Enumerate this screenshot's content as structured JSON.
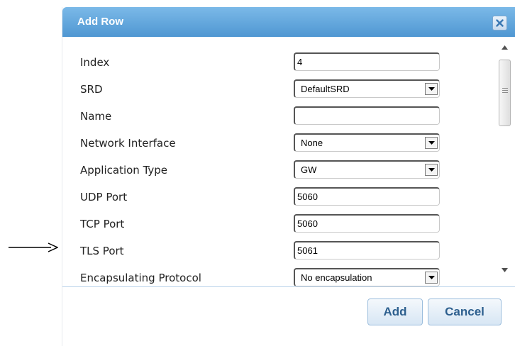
{
  "dialog": {
    "title": "Add Row",
    "close_icon": "close-icon",
    "fields": [
      {
        "key": "index",
        "label": "Index",
        "kind": "text",
        "value": "4"
      },
      {
        "key": "srd",
        "label": "SRD",
        "kind": "select",
        "value": "DefaultSRD"
      },
      {
        "key": "name",
        "label": "Name",
        "kind": "text",
        "value": ""
      },
      {
        "key": "network-interface",
        "label": "Network Interface",
        "kind": "select",
        "value": "None"
      },
      {
        "key": "application-type",
        "label": "Application Type",
        "kind": "select",
        "value": "GW"
      },
      {
        "key": "udp-port",
        "label": "UDP Port",
        "kind": "text",
        "value": "5060"
      },
      {
        "key": "tcp-port",
        "label": "TCP Port",
        "kind": "text",
        "value": "5060"
      },
      {
        "key": "tls-port",
        "label": "TLS Port",
        "kind": "text",
        "value": "5061"
      },
      {
        "key": "encapsulating-protocol",
        "label": "Encapsulating Protocol",
        "kind": "select",
        "value": "No encapsulation"
      }
    ],
    "buttons": {
      "add": "Add",
      "cancel": "Cancel"
    }
  },
  "annotation": {
    "arrow_icon": "arrow-right-icon",
    "points_to": "TLS Port"
  },
  "colors": {
    "title_bar_top": "#7bb9e8",
    "title_bar_bottom": "#4f97d2",
    "button_text": "#2d5f8e"
  }
}
